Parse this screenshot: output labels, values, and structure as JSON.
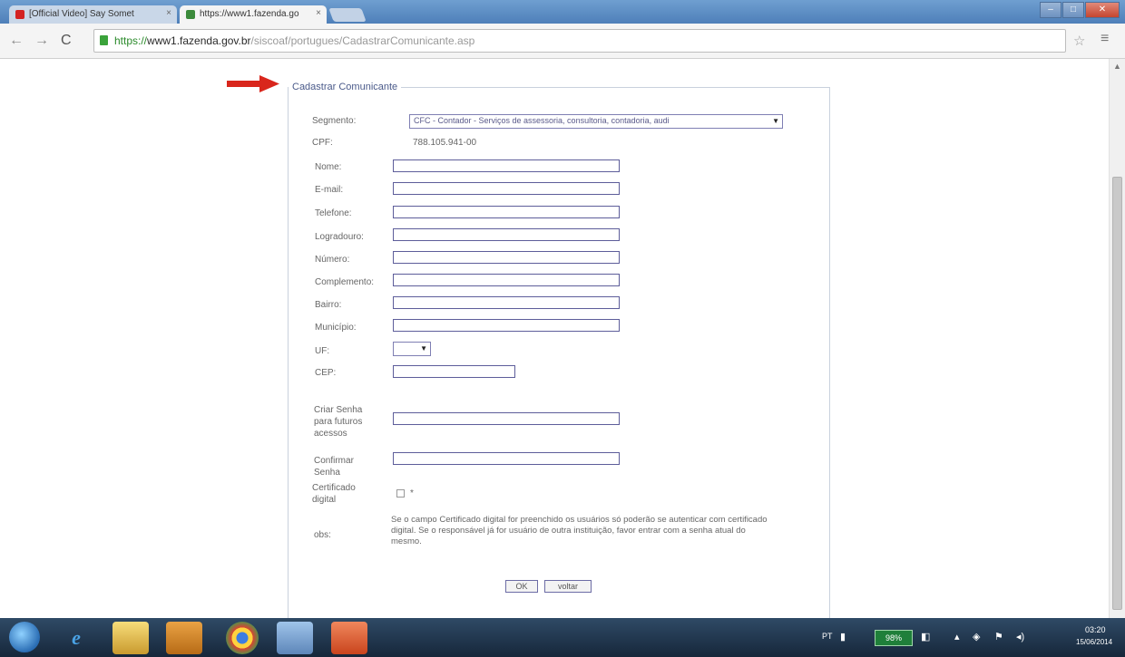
{
  "browser": {
    "tabs": [
      {
        "title": "[Official Video] Say Somet"
      },
      {
        "title": "https://www1.fazenda.go"
      }
    ],
    "url": {
      "scheme": "https://",
      "host": "www1.fazenda.gov.br",
      "path": "/siscoaf/portugues/CadastrarComunicante.asp"
    }
  },
  "form": {
    "legend": "Cadastrar Comunicante",
    "segmento": {
      "label": "Segmento:",
      "selected": "CFC - Contador - Serviços de assessoria, consultoria, contadoria, audi"
    },
    "cpf": {
      "label": "CPF:",
      "value": "788.105.941-00"
    },
    "fields": {
      "nome": "Nome:",
      "email": "E-mail:",
      "telefone": "Telefone:",
      "logradouro": "Logradouro:",
      "numero": "Número:",
      "complemento": "Complemento:",
      "bairro": "Bairro:",
      "municipio": "Município:",
      "uf": "UF:",
      "cep": "CEP:"
    },
    "uf_selected": "",
    "senha": {
      "label_line1": "Criar Senha",
      "label_line2": "para futuros",
      "label_line3": "acessos"
    },
    "confirmar": {
      "label_line1": "Confirmar",
      "label_line2": "Senha"
    },
    "certificado": {
      "label_line1": "Certificado",
      "label_line2": "digital",
      "asterisk": "*"
    },
    "obs": {
      "label": "obs:",
      "text": "Se o campo Certificado digital for preenchido os usuários só poderão se autenticar com certificado digital. Se o responsável já for usuário de outra instituição, favor entrar com a senha atual do mesmo."
    },
    "buttons": {
      "ok": "OK",
      "voltar": "voltar"
    }
  },
  "taskbar": {
    "lang": "PT",
    "battery": "98%",
    "time": "03:20",
    "date": "15/06/2014"
  },
  "colors": {
    "arrow": "#d9261c",
    "input_border": "#5d5d9a",
    "taskbar": "#1e3249"
  }
}
